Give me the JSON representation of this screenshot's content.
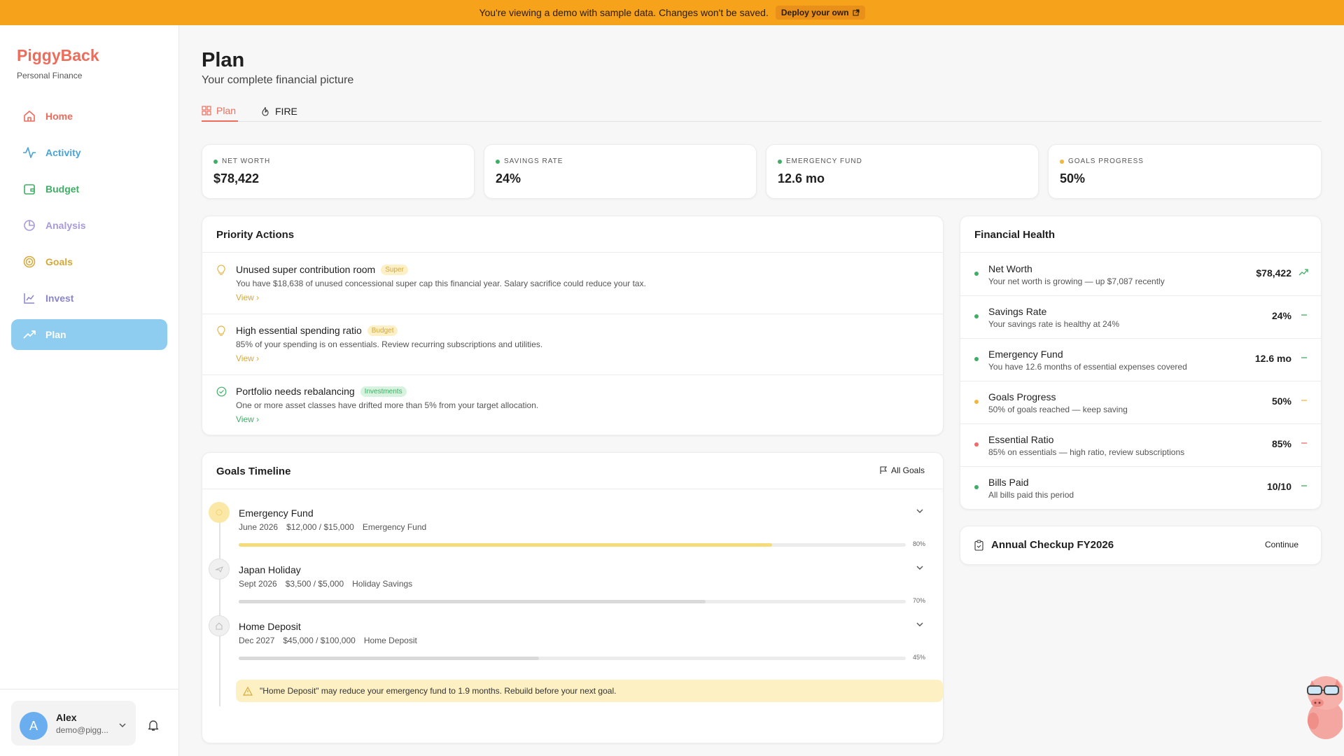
{
  "banner": {
    "message": "You're viewing a demo with sample data. Changes won't be saved.",
    "button": "Deploy your own"
  },
  "sidebar": {
    "brand": "PiggyBack",
    "brand_sub": "Personal Finance",
    "items": [
      {
        "label": "Home",
        "color": "#ef6b5a",
        "icon": "home-icon"
      },
      {
        "label": "Activity",
        "color": "#4aa3d6",
        "icon": "activity-icon"
      },
      {
        "label": "Budget",
        "color": "#3fae64",
        "icon": "wallet-icon"
      },
      {
        "label": "Analysis",
        "color": "#a99ad9",
        "icon": "pie-chart-icon"
      },
      {
        "label": "Goals",
        "color": "#d4a93a",
        "icon": "target-icon"
      },
      {
        "label": "Invest",
        "color": "#8a86c8",
        "icon": "line-chart-icon"
      },
      {
        "label": "Plan",
        "color": "#ffffff",
        "icon": "trending-up-icon"
      }
    ],
    "user": {
      "initial": "A",
      "name": "Alex",
      "email": "demo@pigg..."
    }
  },
  "page": {
    "title": "Plan",
    "subtitle": "Your complete financial picture",
    "tabs": [
      {
        "label": "Plan"
      },
      {
        "label": "FIRE"
      }
    ]
  },
  "stats": [
    {
      "label": "NET WORTH",
      "value": "$78,422",
      "color": "#3fae64"
    },
    {
      "label": "SAVINGS RATE",
      "value": "24%",
      "color": "#3fae64"
    },
    {
      "label": "EMERGENCY FUND",
      "value": "12.6 mo",
      "color": "#3fae64"
    },
    {
      "label": "GOALS PROGRESS",
      "value": "50%",
      "color": "#f1b73c"
    }
  ],
  "priority": {
    "title": "Priority Actions",
    "items": [
      {
        "title": "Unused super contribution room",
        "tag": "Super",
        "desc": "You have $18,638 of unused concessional super cap this financial year. Salary sacrifice could reduce your tax.",
        "view": "View"
      },
      {
        "title": "High essential spending ratio",
        "tag": "Budget",
        "desc": "85% of your spending is on essentials. Review recurring subscriptions and utilities.",
        "view": "View"
      },
      {
        "title": "Portfolio needs rebalancing",
        "tag": "Investments",
        "desc": "One or more asset classes have drifted more than 5% from your target allocation.",
        "view": "View"
      }
    ]
  },
  "timeline": {
    "title": "Goals Timeline",
    "all_goals": "All Goals",
    "goals": [
      {
        "name": "Emergency Fund",
        "date": "June 2026",
        "amount": "$12,000 / $15,000",
        "account": "Emergency Fund",
        "pct": "80%",
        "progress": 0.8,
        "color": "#f5dc7a"
      },
      {
        "name": "Japan Holiday",
        "date": "Sept 2026",
        "amount": "$3,500 / $5,000",
        "account": "Holiday Savings",
        "pct": "70%",
        "progress": 0.7,
        "color": "#d9d9d9"
      },
      {
        "name": "Home Deposit",
        "date": "Dec 2027",
        "amount": "$45,000 / $100,000",
        "account": "Home Deposit",
        "pct": "45%",
        "progress": 0.45,
        "color": "#d9d9d9"
      }
    ],
    "warning": "\"Home Deposit\" may reduce your emergency fund to 1.9 months. Rebuild before your next goal."
  },
  "health": {
    "title": "Financial Health",
    "rows": [
      {
        "name": "Net Worth",
        "desc": "Your net worth is growing — up $7,087 recently",
        "value": "$78,422",
        "color": "#3fae64",
        "trend": "up"
      },
      {
        "name": "Savings Rate",
        "desc": "Your savings rate is healthy at 24%",
        "value": "24%",
        "color": "#3fae64",
        "trend": "flat"
      },
      {
        "name": "Emergency Fund",
        "desc": "You have 12.6 months of essential expenses covered",
        "value": "12.6 mo",
        "color": "#3fae64",
        "trend": "flat"
      },
      {
        "name": "Goals Progress",
        "desc": "50% of goals reached — keep saving",
        "value": "50%",
        "color": "#f1b73c",
        "trend": "flat"
      },
      {
        "name": "Essential Ratio",
        "desc": "85% on essentials — high ratio, review subscriptions",
        "value": "85%",
        "color": "#ef6b6b",
        "trend": "flat"
      },
      {
        "name": "Bills Paid",
        "desc": "All bills paid this period",
        "value": "10/10",
        "color": "#3fae64",
        "trend": "flat"
      }
    ]
  },
  "checkup": {
    "title": "Annual Checkup FY2026",
    "button": "Continue"
  }
}
